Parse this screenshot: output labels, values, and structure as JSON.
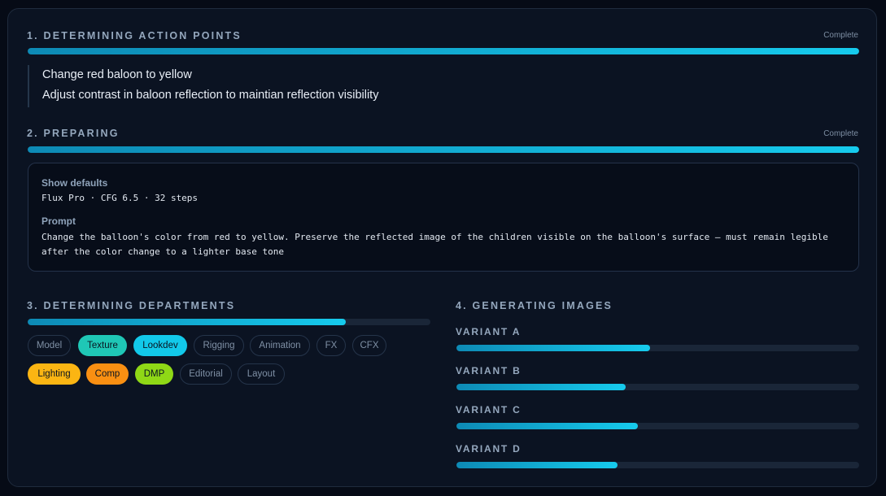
{
  "steps": {
    "action_points": {
      "title": "1. DETERMINING ACTION POINTS",
      "status": "Complete",
      "progress": 1.0,
      "items": [
        "Change red baloon to yellow",
        "Adjust contrast in baloon reflection to maintian reflection visibility"
      ]
    },
    "preparing": {
      "title": "2. PREPARING",
      "status": "Complete",
      "progress": 1.0,
      "defaults_label": "Show defaults",
      "defaults_value": "Flux Pro · CFG 6.5 · 32 steps",
      "prompt_label": "Prompt",
      "prompt_lines": [
        "Change the balloon's color from red to yellow. Preserve the reflected image of the children visible on the balloon's surface — must remain legible",
        "after the color change to a lighter base tone"
      ]
    },
    "departments": {
      "title": "3. DETERMINING DEPARTMENTS",
      "progress": 0.79,
      "chips": [
        {
          "label": "Model",
          "active": false
        },
        {
          "label": "Texture",
          "active": true,
          "color": "#1fc7b6"
        },
        {
          "label": "Lookdev",
          "active": true,
          "color": "#12c9ea"
        },
        {
          "label": "Rigging",
          "active": false
        },
        {
          "label": "Animation",
          "active": false
        },
        {
          "label": "FX",
          "active": false
        },
        {
          "label": "CFX",
          "active": false
        },
        {
          "label": "Lighting",
          "active": true,
          "color": "#fbb513"
        },
        {
          "label": "Comp",
          "active": true,
          "color": "#f98f12"
        },
        {
          "label": "DMP",
          "active": true,
          "color": "#8fd816"
        },
        {
          "label": "Editorial",
          "active": false
        },
        {
          "label": "Layout",
          "active": false
        }
      ]
    },
    "generating": {
      "title": "4. GENERATING IMAGES",
      "variants": [
        {
          "label": "VARIANT A",
          "progress": 0.48
        },
        {
          "label": "VARIANT B",
          "progress": 0.42
        },
        {
          "label": "VARIANT C",
          "progress": 0.45
        },
        {
          "label": "VARIANT D",
          "progress": 0.4
        }
      ]
    }
  }
}
